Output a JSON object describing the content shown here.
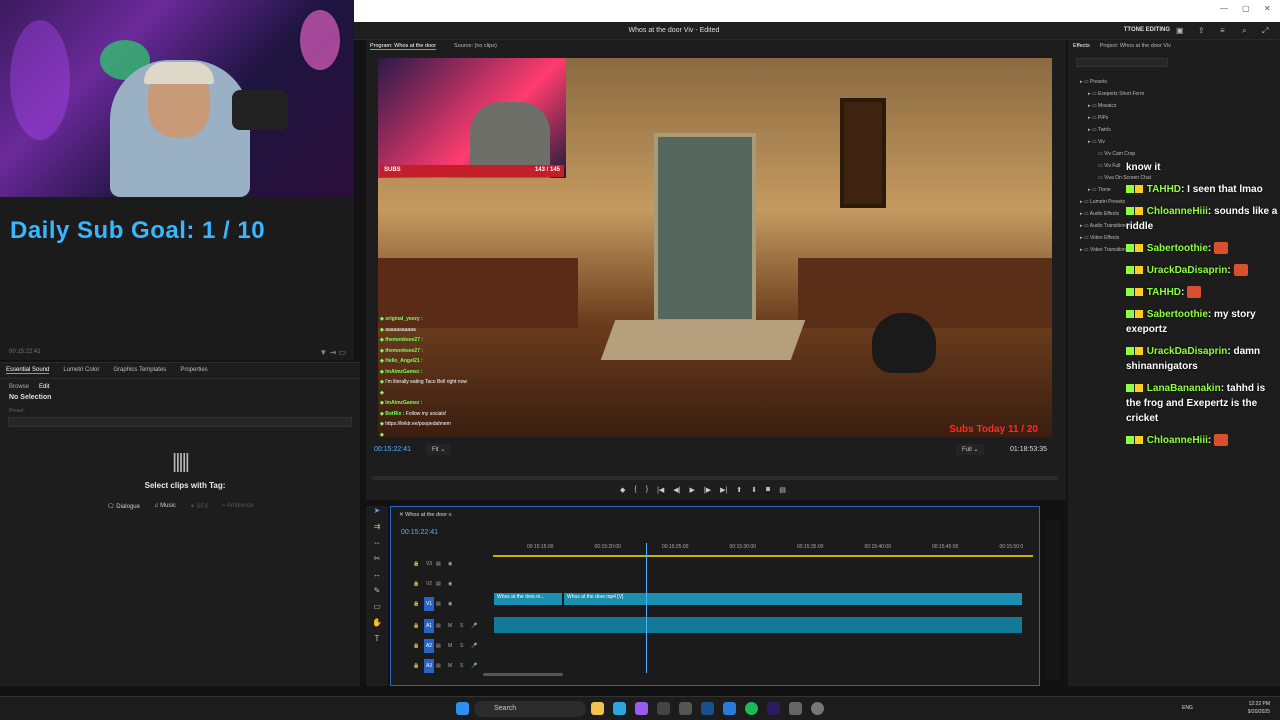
{
  "webcam": {
    "overlay": "DAILY SUB GOAL"
  },
  "left_panel": {
    "sub_goal": "Daily Sub Goal:  1 / 10",
    "timestamp": "00:15:22:41"
  },
  "window": {
    "title": "Whos at the door Viv - Edited",
    "workspace": "TTONE EDITING"
  },
  "essential_sound": {
    "tabs": [
      "Essential Sound",
      "Lumetri Color",
      "Graphics Templates",
      "Properties"
    ],
    "subtabs": [
      "Browse",
      "Edit"
    ],
    "no_selection": "No Selection",
    "preset_label": "Preset:",
    "select_clips": "Select clips with Tag:",
    "tags": [
      "Dialogue",
      "Music",
      "SFX",
      "Ambience"
    ]
  },
  "monitor": {
    "tabs": [
      "Program: Whos at the door",
      "Source: (no clips)"
    ],
    "current_time": "00:15:22:41",
    "fit": "Fit",
    "resolution": "Full",
    "duration": "01:18:53:35",
    "subs_label": "SUBS",
    "subs_count": "143 / 145",
    "subs_today": "Subs Today  11 / 20",
    "overlay_chat": [
      {
        "user": "original_yeezy :",
        "text": ""
      },
      {
        "user": "",
        "text": "aaaaaaaaaaa"
      },
      {
        "user": "themonkeee27 :",
        "text": ""
      },
      {
        "user": "themonkeee27 :",
        "text": ""
      },
      {
        "user": "Hello_Angel21 :",
        "text": ""
      },
      {
        "user": "ImAimzGamez :",
        "text": ""
      },
      {
        "user": "",
        "text": "I'm literally eating Taco Bell right now"
      },
      {
        "user": "",
        "text": ""
      },
      {
        "user": "ImAimzGamez :",
        "text": ""
      },
      {
        "user": "BotRix :",
        "text": "Follow my socials!"
      },
      {
        "user": "",
        "text": "https://linktr.ee/poopedahnem"
      },
      {
        "user": "",
        "text": ""
      }
    ]
  },
  "effects": {
    "tabs": [
      "Effects",
      "Project: Whos at the door Viv"
    ],
    "tree": [
      {
        "level": 0,
        "label": "Presets"
      },
      {
        "level": 1,
        "label": "Exepertz Short Form"
      },
      {
        "level": 1,
        "label": "Mosaics"
      },
      {
        "level": 1,
        "label": "PiPs"
      },
      {
        "level": 1,
        "label": "Twirls"
      },
      {
        "level": 1,
        "label": "Viv"
      },
      {
        "level": 2,
        "label": "Viv Cam Crop"
      },
      {
        "level": 2,
        "label": "Viv Full"
      },
      {
        "level": 2,
        "label": "Viva On Screen Chat"
      },
      {
        "level": 1,
        "label": "Ttone"
      },
      {
        "level": 0,
        "label": "Lumetri Presets"
      },
      {
        "level": 0,
        "label": "Audio Effects"
      },
      {
        "level": 0,
        "label": "Audio Transitions"
      },
      {
        "level": 0,
        "label": "Video Effects"
      },
      {
        "level": 0,
        "label": "Video Transitions"
      }
    ]
  },
  "chat": [
    {
      "name": "",
      "text": "know it"
    },
    {
      "name": "TAHHD",
      "text": ": I seen that lmao"
    },
    {
      "name": "ChloanneHiii",
      "text": ": sounds like a riddle"
    },
    {
      "name": "Sabertoothie",
      "text": ":"
    },
    {
      "name": "UrackDaDisaprin",
      "text": ":"
    },
    {
      "name": "TAHHD",
      "text": ":"
    },
    {
      "name": "Sabertoothie",
      "text": ": my story exeportz"
    },
    {
      "name": "UrackDaDisaprin",
      "text": ": damn shinannigators"
    },
    {
      "name": "LanaBananakin",
      "text": ": tahhd is the frog and Exepertz is the cricket"
    },
    {
      "name": "ChloanneHiii",
      "text": ":"
    }
  ],
  "timeline": {
    "sequence": "Whos at the door",
    "time": "00:15:22:41",
    "ruler": [
      "00:15:15:00",
      "00:15:20:00",
      "00:15:25:00",
      "00:15:30:00",
      "00:15:35:00",
      "00:15:40:00",
      "00:15:45:00",
      "00:15:50:0"
    ],
    "video_tracks": [
      "V3",
      "V2",
      "V1"
    ],
    "audio_tracks": [
      "A1",
      "A2",
      "A3"
    ],
    "clip1": "Whos at the door.m...",
    "clip2": "Whos at the door.mp4 [V]"
  },
  "taskbar": {
    "search": "Search",
    "lang": "ENG",
    "time": "12:22 PM",
    "date": "9/20/2025"
  }
}
